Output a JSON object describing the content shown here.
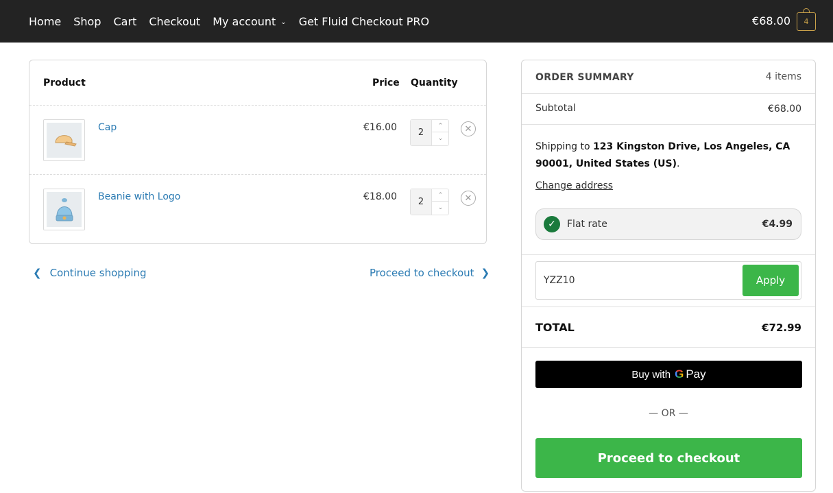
{
  "nav": {
    "items": [
      "Home",
      "Shop",
      "Cart",
      "Checkout",
      "My account",
      "Get Fluid Checkout PRO"
    ],
    "cart_total": "€68.00",
    "cart_count": "4"
  },
  "cart": {
    "headers": {
      "product": "Product",
      "price": "Price",
      "quantity": "Quantity"
    },
    "rows": [
      {
        "name": "Cap",
        "price": "€16.00",
        "qty": "2"
      },
      {
        "name": "Beanie with Logo",
        "price": "€18.00",
        "qty": "2"
      }
    ],
    "continue_shopping": "Continue shopping",
    "proceed_link": "Proceed to checkout"
  },
  "summary": {
    "title": "ORDER SUMMARY",
    "items_count": "4 items",
    "subtotal_label": "Subtotal",
    "subtotal_value": "€68.00",
    "shipping_prefix": "Shipping to",
    "shipping_address": "123 Kingston Drive, Los Angeles, CA 90001, United States (US)",
    "shipping_suffix": ".",
    "change_address": "Change address",
    "rate_label": "Flat rate",
    "rate_value": "€4.99",
    "coupon_value": "YZZ10",
    "apply_label": "Apply",
    "total_label": "TOTAL",
    "total_value": "€72.99",
    "gpay_prefix": "Buy with",
    "gpay_g": "G",
    "gpay_pay": "Pay",
    "or_text": "— OR —",
    "checkout_button": "Proceed to checkout"
  },
  "colors": {
    "header_bg": "#232323",
    "link_blue": "#2b7bb3",
    "accent_green": "#3cb649",
    "check_green": "#1a7a3c",
    "cart_gold": "#c9a14a"
  },
  "icons": [
    "chevron-down-icon",
    "cart-bag-icon",
    "cap-image",
    "beanie-image",
    "arrow-up-icon",
    "arrow-down-icon",
    "remove-icon",
    "chevron-left-icon",
    "chevron-right-icon",
    "check-icon",
    "google-g-icon"
  ]
}
